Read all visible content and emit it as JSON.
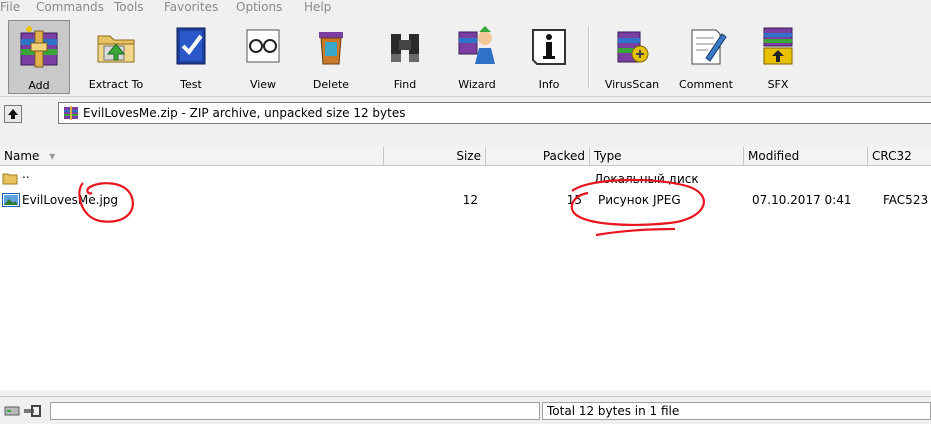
{
  "menu": [
    "File",
    "Commands",
    "Tools",
    "Favorites",
    "Options",
    "Help"
  ],
  "toolbar": {
    "add": "Add",
    "extract_to": "Extract To",
    "test": "Test",
    "view": "View",
    "delete": "Delete",
    "find": "Find",
    "wizard": "Wizard",
    "info": "Info",
    "virusscan": "VirusScan",
    "comment": "Comment",
    "sfx": "SFX"
  },
  "path_text": "EvilLovesMe.zip - ZIP archive, unpacked size 12 bytes",
  "columns": {
    "name": "Name",
    "size": "Size",
    "packed": "Packed",
    "type": "Type",
    "modified": "Modified",
    "crc32": "CRC32"
  },
  "rows": [
    {
      "name": "..",
      "size": "",
      "packed": "",
      "type": "Локальный диск",
      "modified": "",
      "crc": ""
    },
    {
      "name": "EvilLovesMe.jpg",
      "size": "12",
      "packed": "15",
      "type": "Рисунок JPEG",
      "modified": "07.10.2017 0:41",
      "crc": "FAC523"
    }
  ],
  "status": {
    "right": "Total 12 bytes in 1 file"
  },
  "colors": {
    "annotation": "#e8141e",
    "accent": "#1d4fb8"
  }
}
